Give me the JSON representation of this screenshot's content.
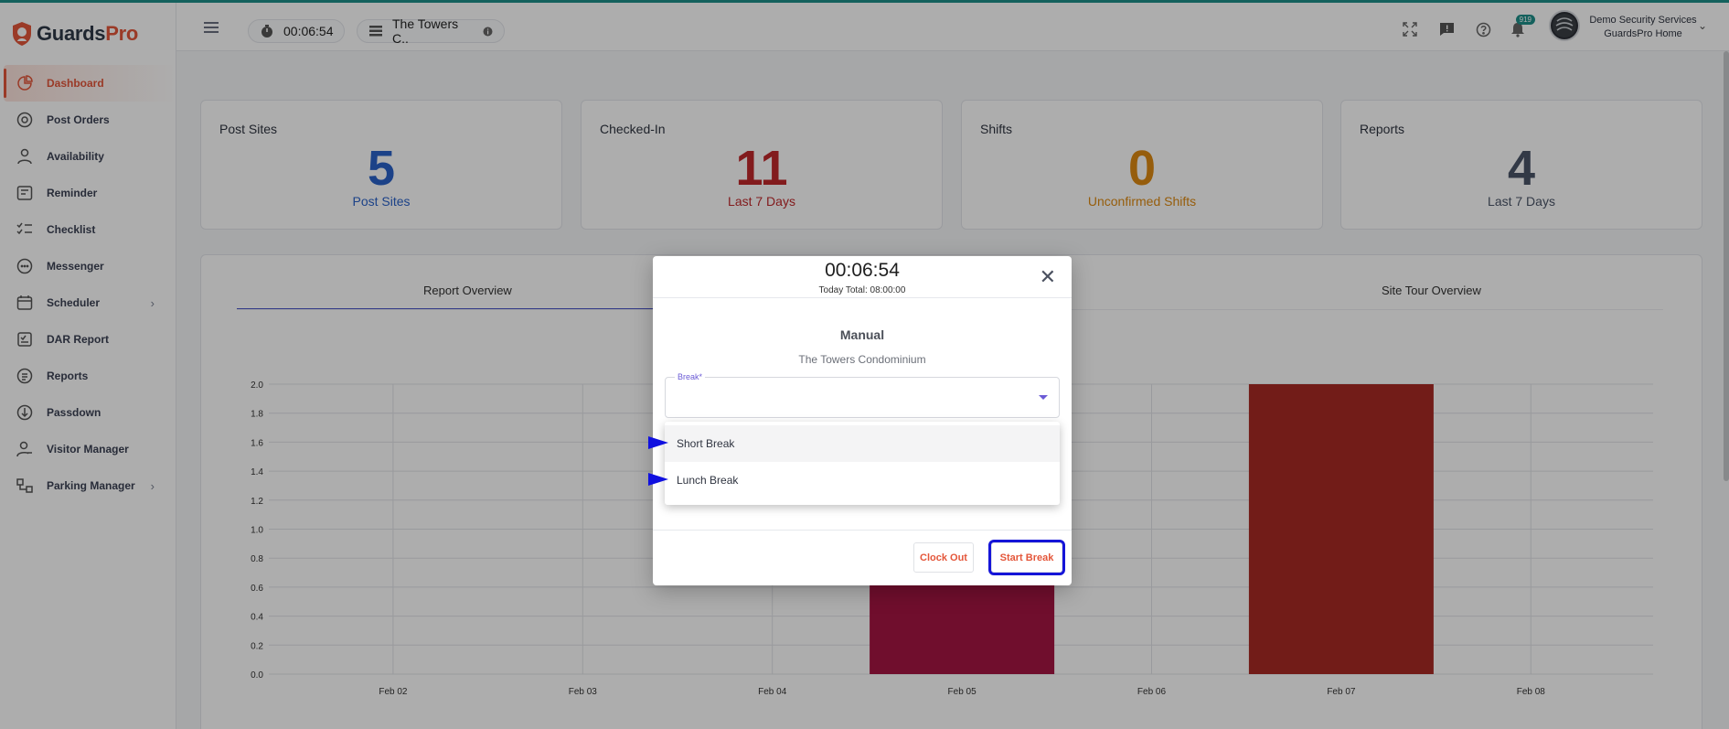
{
  "brand": {
    "name_a": "Guards",
    "name_b": "Pro"
  },
  "sidebar": {
    "items": [
      {
        "label": "Dashboard",
        "icon": "dashboard-icon",
        "active": true
      },
      {
        "label": "Post Orders",
        "icon": "post-orders-icon"
      },
      {
        "label": "Availability",
        "icon": "availability-icon"
      },
      {
        "label": "Reminder",
        "icon": "reminder-icon"
      },
      {
        "label": "Checklist",
        "icon": "checklist-icon"
      },
      {
        "label": "Messenger",
        "icon": "messenger-icon"
      },
      {
        "label": "Scheduler",
        "icon": "scheduler-icon",
        "has_children": true
      },
      {
        "label": "DAR Report",
        "icon": "dar-report-icon"
      },
      {
        "label": "Reports",
        "icon": "reports-icon"
      },
      {
        "label": "Passdown",
        "icon": "passdown-icon"
      },
      {
        "label": "Visitor Manager",
        "icon": "visitor-manager-icon"
      },
      {
        "label": "Parking Manager",
        "icon": "parking-manager-icon",
        "has_children": true
      }
    ]
  },
  "header": {
    "timer": "00:06:54",
    "site": "The Towers C..",
    "notifications_count": "919",
    "account_line1": "Demo Security Services",
    "account_line2": "GuardsPro Home"
  },
  "stats": [
    {
      "title": "Post Sites",
      "value": "5",
      "subtitle": "Post Sites",
      "color": "#2a62c9"
    },
    {
      "title": "Checked-In",
      "value": "11",
      "subtitle": "Last 7 Days",
      "color": "#c0292c"
    },
    {
      "title": "Shifts",
      "value": "0",
      "subtitle": "Unconfirmed Shifts",
      "color": "#de8a12"
    },
    {
      "title": "Reports",
      "value": "4",
      "subtitle": "Last 7 Days",
      "color": "#4b5568"
    }
  ],
  "tabs": {
    "report_overview": "Report Overview",
    "site_tour_overview": "Site Tour Overview"
  },
  "chart_data": {
    "type": "bar",
    "categories": [
      "Feb 02",
      "Feb 03",
      "Feb 04",
      "Feb 05",
      "Feb 06",
      "Feb 07",
      "Feb 08"
    ],
    "values": [
      0,
      0,
      0,
      1,
      0,
      2,
      0
    ],
    "bar_colors": [
      "#a51543",
      "#a51543",
      "#a51543",
      "#a51543",
      "#a51543",
      "#a82a24",
      "#a51543"
    ],
    "ylim": [
      0,
      2.0
    ],
    "yticks": [
      "0.0",
      "0.2",
      "0.4",
      "0.6",
      "0.8",
      "1.0",
      "1.2",
      "1.4",
      "1.6",
      "1.8",
      "2.0"
    ],
    "grid": true
  },
  "modal": {
    "time": "00:06:54",
    "today_total": "Today Total: 08:00:00",
    "mode": "Manual",
    "site": "The Towers Condominium",
    "field_label": "Break*",
    "options": [
      "Short Break",
      "Lunch Break"
    ],
    "clock_out": "Clock Out",
    "start_break": "Start Break"
  }
}
